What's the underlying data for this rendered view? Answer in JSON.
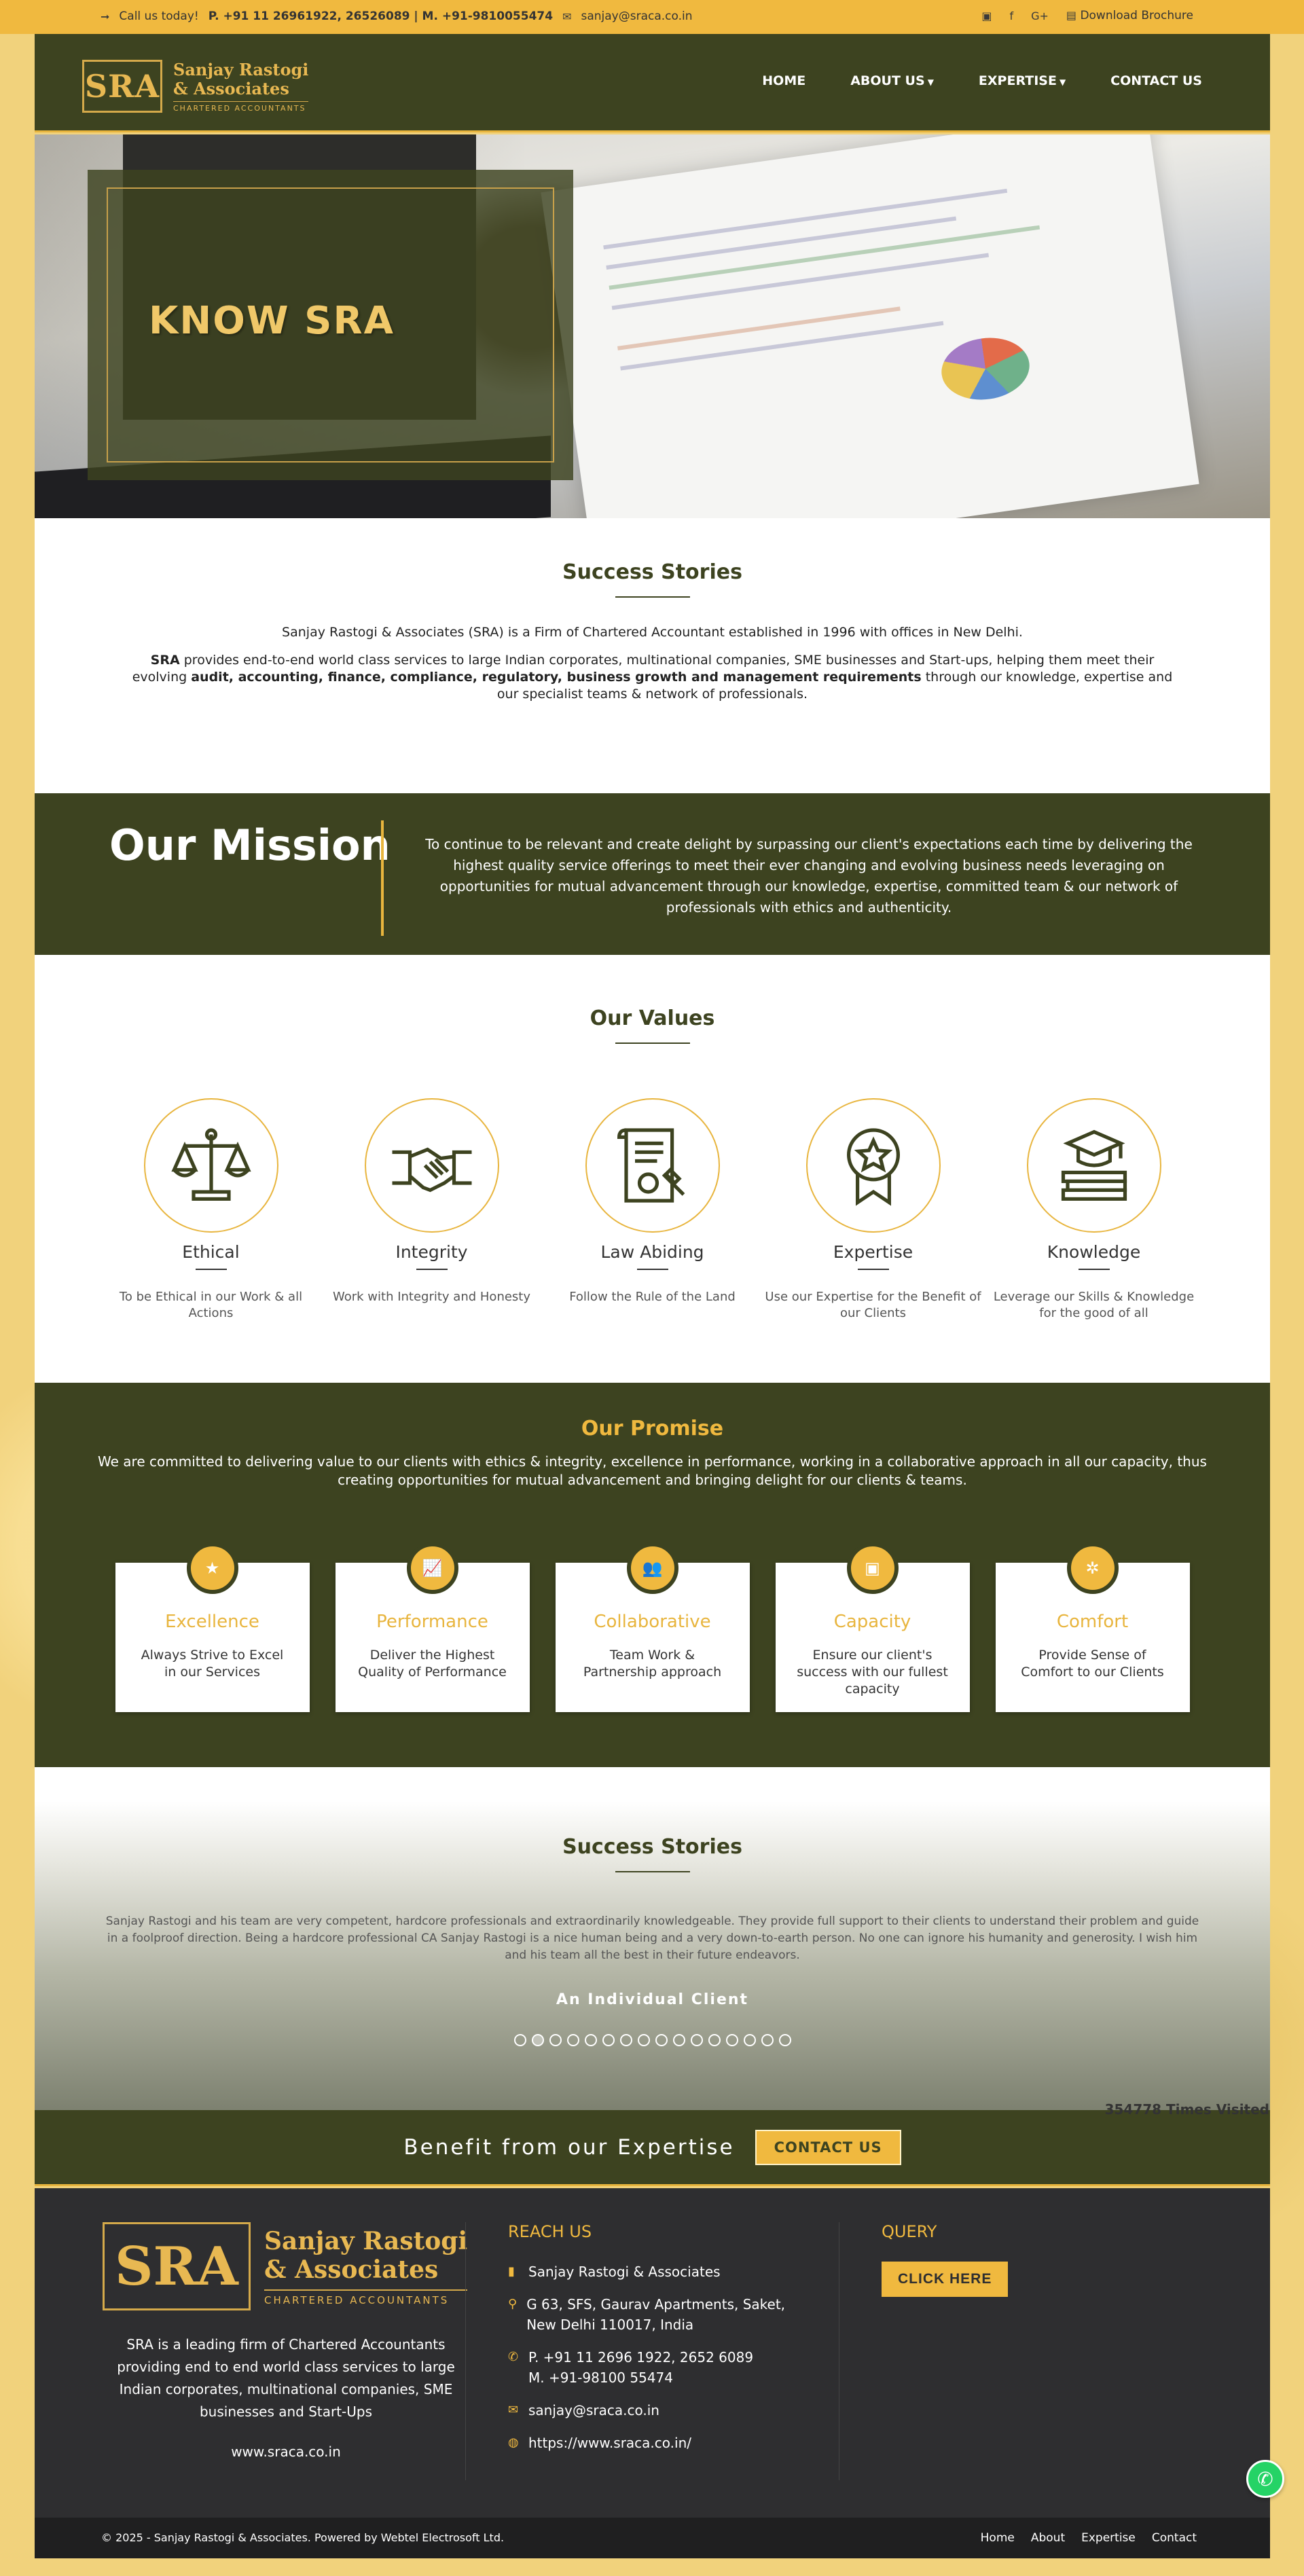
{
  "topbar": {
    "call_prefix": "Call us today!",
    "phones": "P. +91 11 26961922, 26526089 | M. +91-9810055474",
    "email": "sanjay@sraca.co.in",
    "social": [
      "linkedin-icon",
      "facebook-icon",
      "googleplus-icon"
    ],
    "brochure": "Download Brochure",
    "googleplus_label": "G+"
  },
  "header": {
    "logo_mark": "SRA",
    "logo_name_1": "Sanjay Rastogi",
    "logo_name_2": "& Associates",
    "logo_tagline": "CHARTERED ACCOUNTANTS",
    "nav": [
      {
        "label": "HOME"
      },
      {
        "label": "ABOUT US"
      },
      {
        "label": "EXPERTISE"
      },
      {
        "label": "CONTACT US"
      }
    ]
  },
  "hero": {
    "title": "KNOW SRA"
  },
  "about": {
    "title": "Success Stories",
    "line1": "Sanjay Rastogi & Associates (SRA) is a Firm of Chartered Accountant established in 1996 with offices in New Delhi.",
    "line2_bold_start": "SRA",
    "line2_part1": " provides end-to-end world class services to large Indian corporates, multinational companies, SME businesses and Start-ups, helping them meet their evolving ",
    "line2_bold_mid": "audit, accounting, finance, compliance, regulatory, business growth and management requirements",
    "line2_part2": " through our knowledge, expertise and our specialist teams & network of professionals."
  },
  "mission": {
    "title": "Our Mission",
    "text": "To continue to be relevant and create delight by surpassing our client's expectations each time by delivering the highest quality service offerings to meet their ever changing and evolving business needs leveraging on opportunities for mutual advancement through our knowledge, expertise, committed team & our network of professionals with ethics and authenticity."
  },
  "values": {
    "title": "Our Values",
    "items": [
      {
        "title": "Ethical",
        "desc": "To be Ethical in our Work & all Actions",
        "icon": "scales-icon"
      },
      {
        "title": "Integrity",
        "desc": "Work with Integrity and Honesty",
        "icon": "handshake-icon"
      },
      {
        "title": "Law Abiding",
        "desc": "Follow the Rule of the Land",
        "icon": "law-document-icon"
      },
      {
        "title": "Expertise",
        "desc": "Use our Expertise for the Benefit of our Clients",
        "icon": "award-badge-icon"
      },
      {
        "title": "Knowledge",
        "desc": "Leverage our Skills & Knowledge for the good of all",
        "icon": "graduation-books-icon"
      }
    ]
  },
  "promise": {
    "title": "Our Promise",
    "text": "We are committed to delivering value to our clients with ethics & integrity, excellence in performance, working in a collaborative approach in all our capacity, thus creating opportunities for mutual advancement and bringing delight for our clients & teams.",
    "cards": [
      {
        "title": "Excellence",
        "desc": "Always Strive to Excel in our Services",
        "icon": "star-icon",
        "glyph": "★"
      },
      {
        "title": "Performance",
        "desc": "Deliver the Highest Quality of Performance",
        "icon": "chart-icon",
        "glyph": "📈"
      },
      {
        "title": "Collaborative",
        "desc": "Team Work & Partnership approach",
        "icon": "team-icon",
        "glyph": "👥"
      },
      {
        "title": "Capacity",
        "desc": "Ensure our client's success with our fullest capacity",
        "icon": "capacity-icon",
        "glyph": "▣"
      },
      {
        "title": "Comfort",
        "desc": "Provide Sense of Comfort to our Clients",
        "icon": "comfort-icon",
        "glyph": "✲"
      }
    ]
  },
  "testimonials": {
    "title": "Success Stories",
    "text": "Sanjay Rastogi and his team are very competent, hardcore professionals and extraordinarily knowledgeable. They provide full support to their clients to understand their problem and guide in a foolproof direction. Being a hardcore professional CA Sanjay Rastogi is a nice human being and a very down-to-earth person. No one can ignore his humanity and generosity. I wish him and his team all the best in their future endeavors.",
    "client": "An Individual Client",
    "dot_count": 16,
    "active_dot": 1
  },
  "visits": "354778 Times Visited",
  "benefit": {
    "text": "Benefit from our Expertise",
    "button": "CONTACT US"
  },
  "footer": {
    "logo_mark": "SRA",
    "logo_name_1": "Sanjay Rastogi",
    "logo_name_2": "& Associates",
    "logo_tagline": "CHARTERED ACCOUNTANTS",
    "desc": "SRA is a leading firm of Chartered Accountants providing end to end world class services to large Indian corporates, multinational companies, SME businesses and Start-Ups",
    "website": "www.sraca.co.in",
    "reach_title": "REACH US",
    "firm": "Sanjay Rastogi & Associates",
    "address": "G 63, SFS, Gaurav Apartments, Saket, New Delhi 110017, India",
    "phone1": "P. +91 11 2696 1922, 2652 6089",
    "phone2": "M. +91-98100 55474",
    "email": "sanjay@sraca.co.in",
    "url": "https://www.sraca.co.in/",
    "query_title": "QUERY",
    "query_button": "CLICK HERE"
  },
  "bottombar": {
    "copyright": "© 2025 - Sanjay Rastogi & Associates. Powered by Webtel Electrosoft Ltd.",
    "links": [
      "Home",
      "About",
      "Expertise",
      "Contact"
    ]
  },
  "colors": {
    "brand_olive": "#3d4320",
    "brand_gold": "#f0b93f",
    "footer_dark": "#2e2e30"
  }
}
